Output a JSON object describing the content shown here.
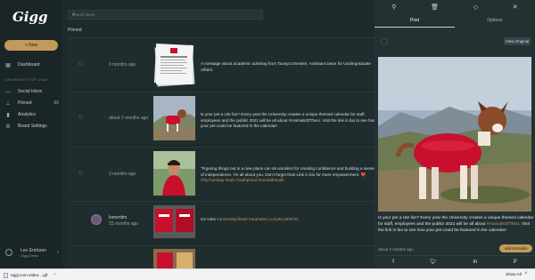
{
  "app": {
    "logo_text": "Gigg",
    "new_label": "+ New"
  },
  "sidebar": {
    "section_label": "UNIVERSITY OF UTAH",
    "items": [
      {
        "label": "Dashboard",
        "icon": "grid-icon"
      },
      {
        "label": "Social Inbox",
        "icon": "inbox-icon"
      },
      {
        "label": "Pinned",
        "icon": "pin-icon",
        "count": "66"
      },
      {
        "label": "Analytics",
        "icon": "chart-icon"
      },
      {
        "label": "Board Settings",
        "icon": "gear-icon"
      }
    ],
    "user": {
      "name": "Leo Erickson",
      "org": "Gigg Demo"
    }
  },
  "main": {
    "search_placeholder": "search items",
    "pinned_label": "Pinned",
    "rows": [
      {
        "time": "3 months ago",
        "text": "A message about academic advising from Taunya Dressler, Assistant Dean for Undergraduate Affairs."
      },
      {
        "time": "about 2 months ago",
        "text": "Is your pet a Ute fan? Every year the University creates a unique themed calendar for staff, employees and the public! 2021 will be all about #AnimalsOfTheU. Visit the link in bio to see how your pet could be featured in the calendar!"
      },
      {
        "time": "3 months ago",
        "text": "\"Figuring things out in a new place can do wonders for creating confidence and building a sense of independence. I'm all about you. Don't forget that! Link in bio for more empowerment. ❤️",
        "hl": "#TipTuesday #uofu #utahproud #mentalhealth"
      },
      {
        "author": "lomentim",
        "time": "15 months ago",
        "text": "Go Utes",
        "hl": "#universityofutah #utahutes t.co/y9UUbXF3A"
      },
      {
        "time": "",
        "text": ""
      }
    ]
  },
  "panel": {
    "tabs": [
      "Post",
      "Options"
    ],
    "view_original": "View Original",
    "caption_main": "Is your pet a Ute fan? Every year the University creates a unique themed calendar for staff, employees and the public! 2021 will be all about",
    "caption_tag": "#AnimalsOfTheU",
    "caption_end": ". Visit the link in bio to see how your pet could be featured in the calendar!",
    "time": "about 2 months ago",
    "schedule_label": "Add Schedule",
    "social": [
      "facebook-icon",
      "twitter-icon",
      "linkedin-icon",
      "pinterest-icon"
    ]
  },
  "downloads": {
    "file": "eggl.com-video....gif",
    "show_all": "Show All"
  },
  "colors": {
    "accent": "#c29a5a",
    "background": "#1e2a2c",
    "panel": "#243133"
  }
}
